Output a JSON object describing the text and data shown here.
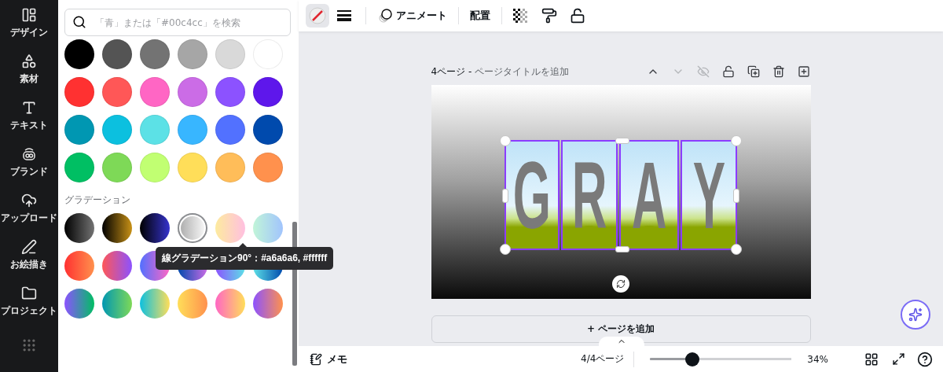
{
  "rail": {
    "items": [
      {
        "kind": "design",
        "label": "デザイン"
      },
      {
        "kind": "elements",
        "label": "素材"
      },
      {
        "kind": "text",
        "label": "テキスト"
      },
      {
        "kind": "brand",
        "label": "ブランド"
      },
      {
        "kind": "upload",
        "label": "アップロード"
      },
      {
        "kind": "draw",
        "label": "お絵描き"
      },
      {
        "kind": "projects",
        "label": "プロジェクト"
      },
      {
        "kind": "apps"
      }
    ]
  },
  "color_panel": {
    "search": {
      "placeholder": "「青」または「#00c4cc」を検索"
    },
    "solid_colors": [
      {
        "color": "#000000"
      },
      {
        "color": "#545454"
      },
      {
        "color": "#737373"
      },
      {
        "color": "#a6a6a6"
      },
      {
        "color": "#d9d9d9"
      },
      {
        "color": "#ffffff"
      },
      {
        "color": "#ff3131"
      },
      {
        "color": "#ff5757"
      },
      {
        "color": "#ff66c4"
      },
      {
        "color": "#cb6ce6"
      },
      {
        "color": "#8c52ff"
      },
      {
        "color": "#5e17eb"
      },
      {
        "color": "#0097b2"
      },
      {
        "color": "#0cc0df"
      },
      {
        "color": "#5ce1e6"
      },
      {
        "color": "#38b6ff"
      },
      {
        "color": "#5271ff"
      },
      {
        "color": "#004aad"
      },
      {
        "color": "#00bf63"
      },
      {
        "color": "#7ed957"
      },
      {
        "color": "#c1ff72"
      },
      {
        "color": "#ffde59"
      },
      {
        "color": "#ffbd59"
      },
      {
        "color": "#ff914d"
      }
    ],
    "gradient_heading": "グラデーション",
    "gradients": [
      {
        "selected": false
      },
      {
        "selected": false
      },
      {
        "selected": false
      },
      {
        "selected": true
      },
      {
        "selected": false
      },
      {
        "selected": false
      },
      {
        "selected": false
      },
      {
        "selected": false
      },
      {
        "selected": false
      },
      {
        "selected": false
      },
      {
        "selected": false
      },
      {
        "selected": false
      },
      {
        "selected": false
      },
      {
        "selected": false
      },
      {
        "selected": false
      },
      {
        "selected": false
      },
      {
        "selected": false
      },
      {
        "selected": false
      }
    ],
    "tooltip": "線グラデーション90°：#a6a6a6, #ffffff"
  },
  "toolbar": {
    "items": [
      {
        "kind": "stroke-color",
        "selected": true
      },
      {
        "kind": "stroke-weight",
        "selected": false
      },
      {
        "kind": "divider"
      },
      {
        "kind": "animate",
        "label": "アニメート",
        "selected": false
      },
      {
        "kind": "divider"
      },
      {
        "kind": "position",
        "label": "配置",
        "selected": false
      },
      {
        "kind": "divider"
      },
      {
        "kind": "transparency",
        "selected": false
      },
      {
        "kind": "copy-style",
        "selected": false
      },
      {
        "kind": "lock",
        "selected": false
      }
    ]
  },
  "page": {
    "number_label": "4ページ -",
    "title_placeholder": "ページタイトルを追加",
    "actions": [
      {
        "kind": "move-up",
        "disabled": false
      },
      {
        "kind": "move-down",
        "disabled": true
      },
      {
        "kind": "hide",
        "disabled": true
      },
      {
        "kind": "lock",
        "disabled": false
      },
      {
        "kind": "duplicate",
        "disabled": false
      },
      {
        "kind": "delete",
        "disabled": false
      },
      {
        "kind": "add",
        "disabled": false
      }
    ],
    "frames": [
      {
        "letter": "G"
      },
      {
        "letter": "R"
      },
      {
        "letter": "A"
      },
      {
        "letter": "Y"
      }
    ]
  },
  "add_page_button": "+ ページを追加",
  "bottom_bar": {
    "notes_label": "メモ",
    "page_count": "4/4ページ",
    "zoom": {
      "level": 0.3
    },
    "zoom_reading": "34%"
  }
}
